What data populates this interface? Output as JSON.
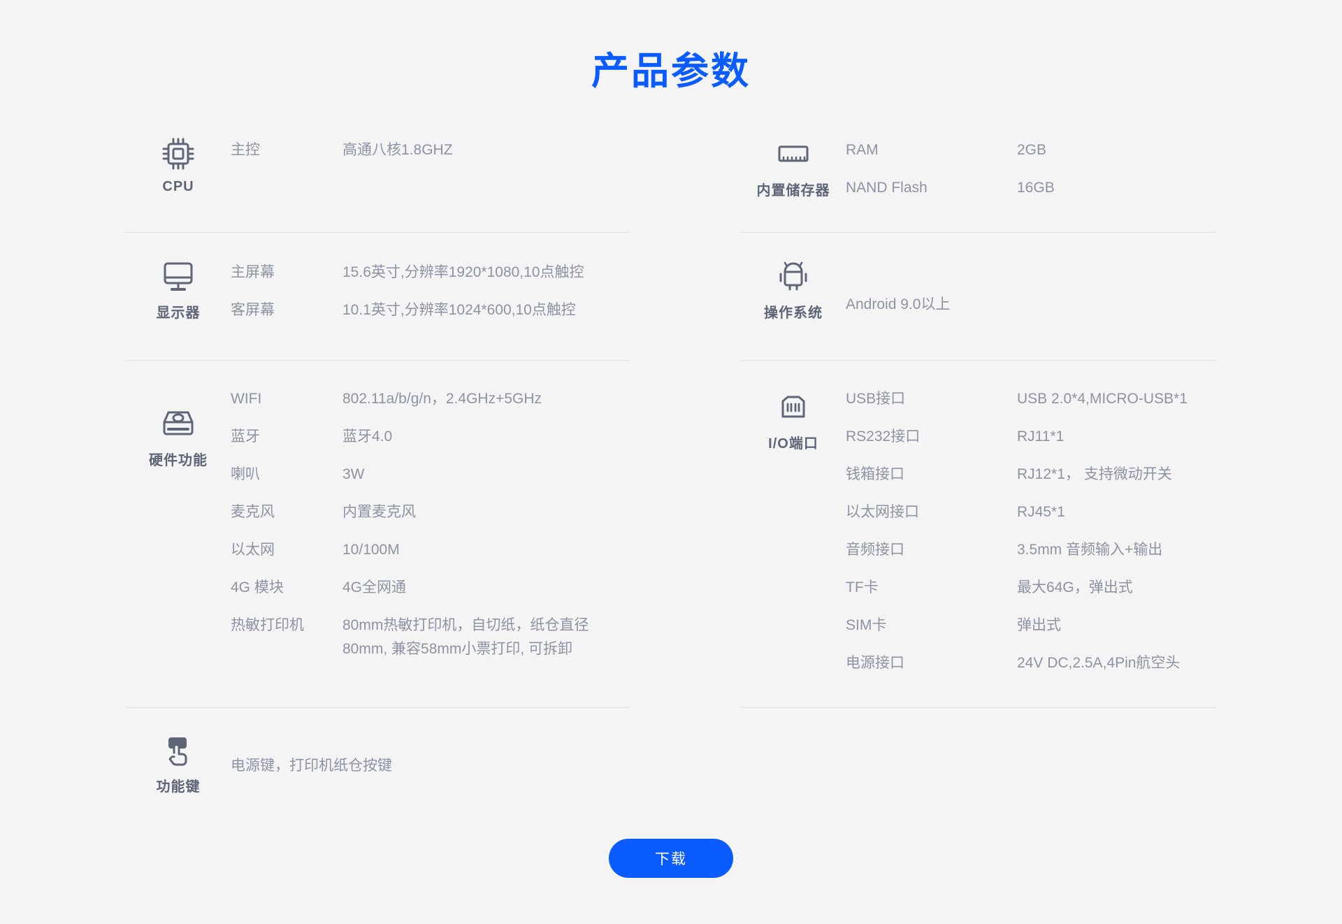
{
  "page": {
    "title": "产品参数",
    "accent_color": "#0b5cff",
    "background_color": "#f4f4f4",
    "text_color": "#8d93a3",
    "caption_color": "#5e6577"
  },
  "sections": {
    "cpu": {
      "icon": "cpu-chip-icon",
      "caption": "CPU",
      "rows": [
        {
          "key": "主控",
          "value": "高通八核1.8GHZ"
        }
      ]
    },
    "storage": {
      "icon": "memory-module-icon",
      "caption": "内置储存器",
      "rows": [
        {
          "key": "RAM",
          "value": "2GB"
        },
        {
          "key": "NAND Flash",
          "value": "16GB"
        }
      ]
    },
    "display": {
      "icon": "monitor-icon",
      "caption": "显示器",
      "rows": [
        {
          "key": "主屏幕",
          "value": "15.6英寸,分辨率1920*1080,10点触控"
        },
        {
          "key": "客屏幕",
          "value": "10.1英寸,分辨率1024*600,10点触控"
        }
      ]
    },
    "os": {
      "icon": "android-robot-icon",
      "caption": "操作系统",
      "value": "Android 9.0以上"
    },
    "hardware": {
      "icon": "hard-drive-icon",
      "caption": "硬件功能",
      "rows": [
        {
          "key": "WIFI",
          "value": "802.11a/b/g/n，2.4GHz+5GHz"
        },
        {
          "key": "蓝牙",
          "value": "蓝牙4.0"
        },
        {
          "key": "喇叭",
          "value": "3W"
        },
        {
          "key": "麦克风",
          "value": "内置麦克风"
        },
        {
          "key": "以太网",
          "value": "10/100M"
        },
        {
          "key": "4G 模块",
          "value": "4G全网通"
        },
        {
          "key": "热敏打印机",
          "value": "80mm热敏打印机，自切纸，纸仓直径80mm, 兼容58mm小票打印, 可拆卸"
        }
      ]
    },
    "io": {
      "icon": "rj45-port-icon",
      "caption": "I/O端口",
      "rows": [
        {
          "key": "USB接口",
          "value": "USB 2.0*4,MICRO-USB*1"
        },
        {
          "key": "RS232接口",
          "value": "RJ11*1"
        },
        {
          "key": "钱箱接口",
          "value": "RJ12*1， 支持微动开关"
        },
        {
          "key": "以太网接口",
          "value": "RJ45*1"
        },
        {
          "key": "音频接口",
          "value": "3.5mm 音频输入+输出"
        },
        {
          "key": "TF卡",
          "value": "最大64G，弹出式"
        },
        {
          "key": "SIM卡",
          "value": "弹出式"
        },
        {
          "key": "电源接口",
          "value": "24V DC,2.5A,4Pin航空头"
        }
      ]
    },
    "function_keys": {
      "icon": "hand-press-button-icon",
      "caption": "功能键",
      "value": "电源键，打印机纸仓按键"
    }
  },
  "footer": {
    "download_label": "下载"
  }
}
